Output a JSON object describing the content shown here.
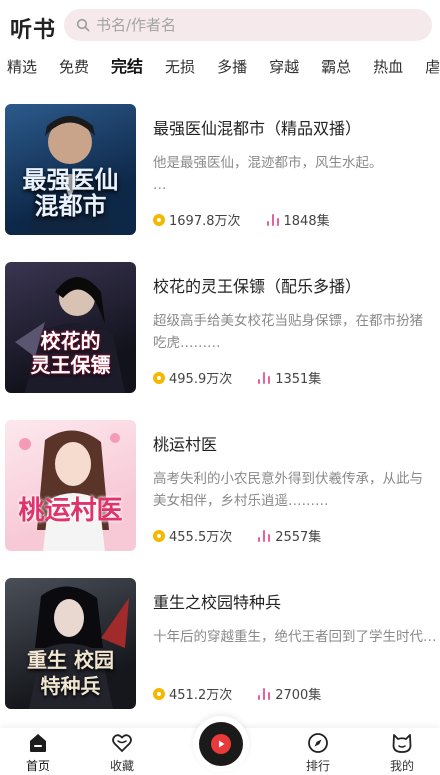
{
  "header": {
    "app_title": "听书",
    "search_placeholder": "书名/作者名"
  },
  "tabs": [
    {
      "label": "精选",
      "active": false
    },
    {
      "label": "免费",
      "active": false
    },
    {
      "label": "完结",
      "active": true
    },
    {
      "label": "无损",
      "active": false
    },
    {
      "label": "多播",
      "active": false
    },
    {
      "label": "穿越",
      "active": false
    },
    {
      "label": "霸总",
      "active": false
    },
    {
      "label": "热血",
      "active": false
    },
    {
      "label": "虐心",
      "active": false
    }
  ],
  "books": [
    {
      "title": "最强医仙混都市（精品双播）",
      "description": "他是最强医仙，混迹都市，风生水起。\n…",
      "plays": "1697.8万次",
      "episodes": "1848集",
      "cover_text": "最强医仙\n混都市",
      "cover_colors": [
        "#0d2747",
        "#2c5a8c"
      ],
      "cover_text_color": "#e8f2ff"
    },
    {
      "title": "校花的灵王保镖（配乐多播）",
      "description": "超级高手给美女校花当贴身保镖，在都市扮猪吃虎………",
      "plays": "495.9万次",
      "episodes": "1351集",
      "cover_text": "校花的\n灵王保镖",
      "cover_colors": [
        "#12121c",
        "#3a3552"
      ],
      "cover_text_color": "#ffffff"
    },
    {
      "title": "桃运村医",
      "description": "高考失利的小农民意外得到伏羲传承，从此与美女相伴，乡村乐逍遥………",
      "plays": "455.5万次",
      "episodes": "2557集",
      "cover_text": "桃运村医",
      "cover_colors": [
        "#f7c9d6",
        "#fde8ee"
      ],
      "cover_text_color": "#e0326b"
    },
    {
      "title": "重生之校园特种兵",
      "description": "十年后的穿越重生，绝代王者回到了学生时代……",
      "plays": "451.2万次",
      "episodes": "2700集",
      "cover_text": "重生 校园\n特种兵",
      "cover_colors": [
        "#15171c",
        "#4a4f58"
      ],
      "cover_text_color": "#f1e6d2"
    }
  ],
  "bottom_nav": {
    "home": "首页",
    "favorites": "收藏",
    "ranking": "排行",
    "mine": "我的"
  },
  "colors": {
    "accent": "#f7c600",
    "search_bg": "#f6e9ec",
    "play_count_icon": "#f5b700",
    "episode_icon": "#e7619a",
    "player_center": "#e83a3a"
  },
  "icons": {
    "search": "search-icon",
    "plays": "coin-icon",
    "episodes": "audio-bars-icon",
    "home": "home-icon",
    "favorites": "heart-icon",
    "player": "disc-play-icon",
    "ranking": "compass-icon",
    "mine": "cat-face-icon"
  }
}
